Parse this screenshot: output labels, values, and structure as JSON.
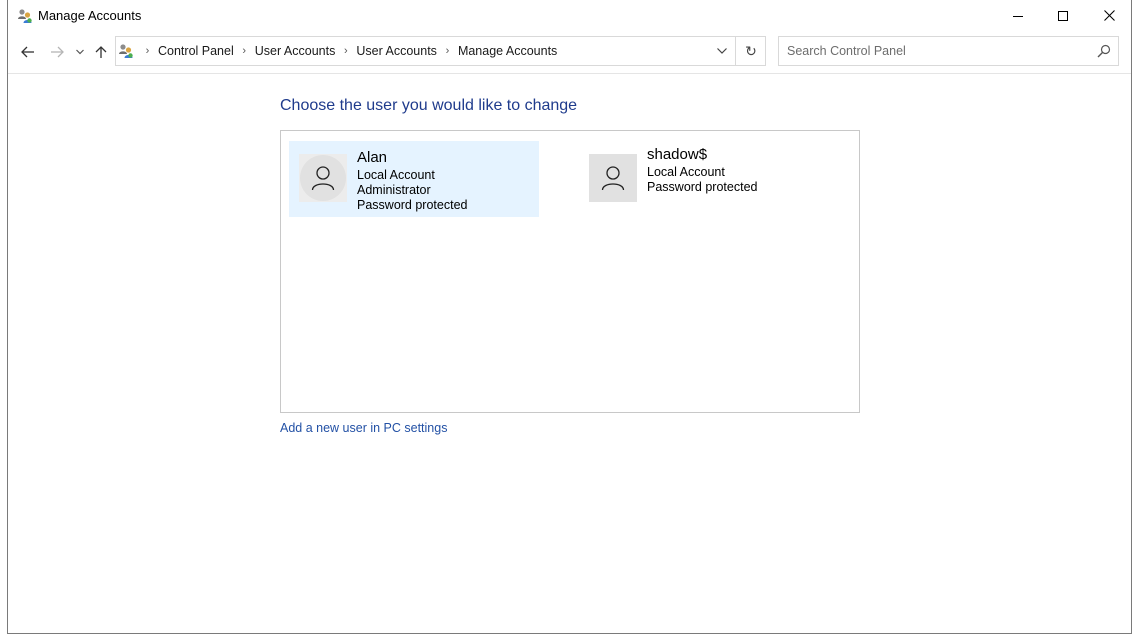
{
  "window": {
    "title": "Manage Accounts",
    "icon": "user-accounts-icon",
    "controls": {
      "minimize": "minimize-icon",
      "maximize": "maximize-icon",
      "close": "close-icon"
    }
  },
  "navigation": {
    "back": "back-arrow-icon",
    "forward": "forward-arrow-icon",
    "recent": "chevron-down-icon",
    "up": "up-arrow-icon"
  },
  "address_bar": {
    "breadcrumbs": [
      "Control Panel",
      "User Accounts",
      "User Accounts",
      "Manage Accounts"
    ],
    "refresh_glyph": "↻"
  },
  "search": {
    "placeholder": "Search Control Panel",
    "value": ""
  },
  "main": {
    "heading": "Choose the user you would like to change",
    "accounts": [
      {
        "name": "Alan",
        "lines": [
          "Local Account",
          "Administrator",
          "Password protected"
        ],
        "selected": true
      },
      {
        "name": "shadow$",
        "lines": [
          "Local Account",
          "Password protected"
        ],
        "selected": false
      }
    ],
    "add_user_link": "Add a new user in PC settings"
  },
  "colors": {
    "heading": "#1f3b8c",
    "link": "#2351a5",
    "selection": "#e5f3ff",
    "avatar_bg": "#e1e1e1"
  }
}
